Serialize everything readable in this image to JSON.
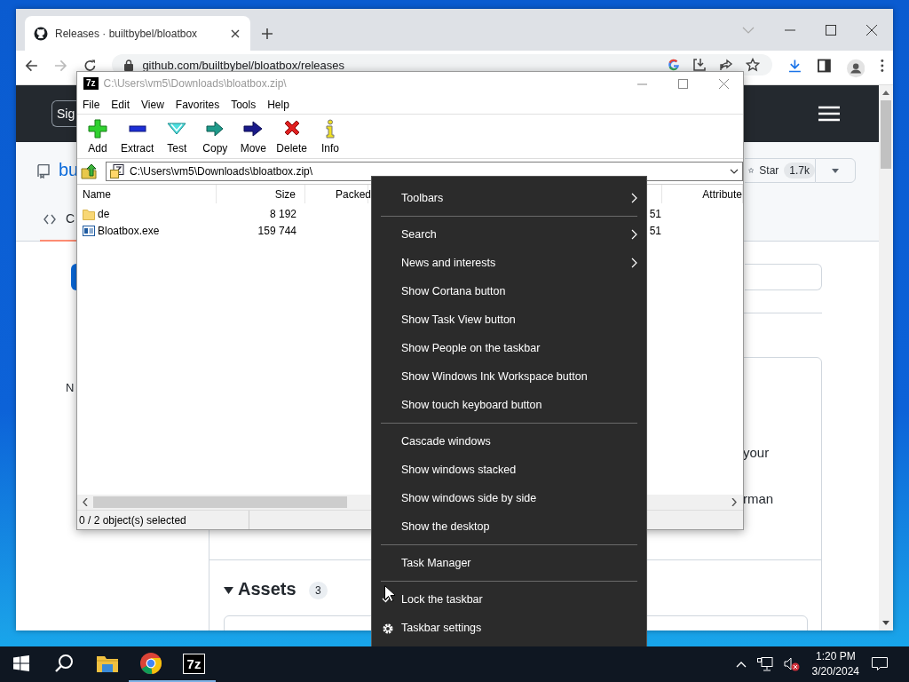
{
  "browser": {
    "tab": {
      "title": "Releases · builtbybel/bloatbox",
      "selected": true
    },
    "forward": {
      "disabled": true
    },
    "url": "github.com/builtbybel/bloatbox/releases",
    "page": {
      "sign_in": "Sig",
      "repo": "bu",
      "star": "Star",
      "star_count": "1.7k",
      "code_tab": "C",
      "sidebar_heading": "N",
      "release_text": [
        "your",
        "rman"
      ],
      "assets": {
        "title": "Assets",
        "count": "3",
        "expanded": true
      }
    }
  },
  "archiver": {
    "logo": "7z",
    "title": "C:\\Users\\vm5\\Downloads\\bloatbox.zip\\",
    "menu": [
      "File",
      "Edit",
      "View",
      "Favorites",
      "Tools",
      "Help"
    ],
    "toolbar": [
      {
        "kind": "add",
        "label": "Add"
      },
      {
        "kind": "extract",
        "label": "Extract"
      },
      {
        "kind": "test",
        "label": "Test"
      },
      {
        "kind": "copy",
        "label": "Copy"
      },
      {
        "kind": "move",
        "label": "Move"
      },
      {
        "kind": "delete",
        "label": "Delete"
      },
      {
        "kind": "info",
        "label": "Info"
      }
    ],
    "path": "C:\\Users\\vm5\\Downloads\\bloatbox.zip\\",
    "columns": [
      "Name",
      "Size",
      "Packed"
    ],
    "right_column": "Attribute",
    "rows": [
      {
        "kind": "folder",
        "name": "de",
        "size": "8 192",
        "modified": "51"
      },
      {
        "kind": "exe",
        "name": "Bloatbox.exe",
        "size": "159 744",
        "modified": "51"
      }
    ],
    "status": "0 / 2 object(s) selected"
  },
  "context_menu": {
    "items": [
      {
        "kind": "item",
        "label": "Toolbars",
        "submenu": true,
        "checked": false
      },
      {
        "kind": "separator"
      },
      {
        "kind": "item",
        "label": "Search",
        "submenu": true,
        "checked": false
      },
      {
        "kind": "item",
        "label": "News and interests",
        "submenu": true,
        "checked": false
      },
      {
        "kind": "item",
        "label": "Show Cortana button",
        "submenu": false,
        "checked": false
      },
      {
        "kind": "item",
        "label": "Show Task View button",
        "submenu": false,
        "checked": false
      },
      {
        "kind": "item",
        "label": "Show People on the taskbar",
        "submenu": false,
        "checked": false
      },
      {
        "kind": "item",
        "label": "Show Windows Ink Workspace button",
        "submenu": false,
        "checked": false
      },
      {
        "kind": "item",
        "label": "Show touch keyboard button",
        "submenu": false,
        "checked": false
      },
      {
        "kind": "separator"
      },
      {
        "kind": "item",
        "label": "Cascade windows",
        "submenu": false,
        "checked": false
      },
      {
        "kind": "item",
        "label": "Show windows stacked",
        "submenu": false,
        "checked": false
      },
      {
        "kind": "item",
        "label": "Show windows side by side",
        "submenu": false,
        "checked": false
      },
      {
        "kind": "item",
        "label": "Show the desktop",
        "submenu": false,
        "checked": false
      },
      {
        "kind": "separator"
      },
      {
        "kind": "item",
        "label": "Task Manager",
        "submenu": false,
        "checked": false
      },
      {
        "kind": "separator"
      },
      {
        "kind": "item",
        "label": "Lock the taskbar",
        "submenu": false,
        "checked": true
      },
      {
        "kind": "settings",
        "label": "Taskbar settings",
        "submenu": false,
        "checked": false
      }
    ]
  },
  "taskbar": {
    "apps": [
      {
        "kind": "explorer",
        "running": false
      },
      {
        "kind": "browser",
        "running": true
      },
      {
        "kind": "archiver",
        "label": "7z",
        "running": true
      }
    ],
    "time": "1:20 PM",
    "date": "3/20/2024"
  }
}
